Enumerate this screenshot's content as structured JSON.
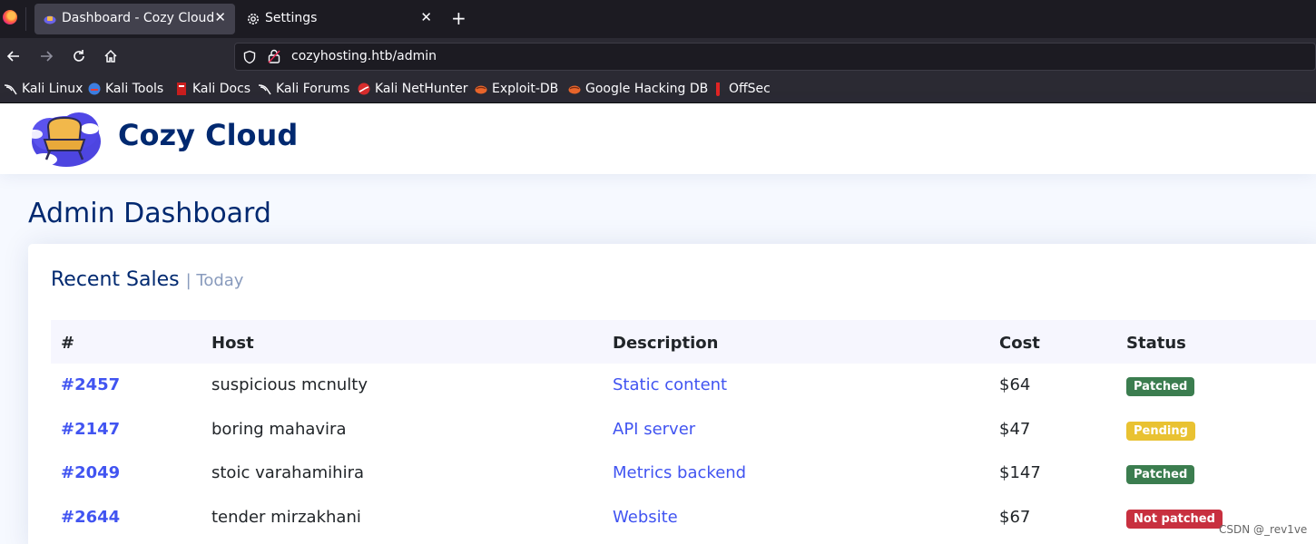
{
  "browser": {
    "tabs": [
      {
        "title": "Dashboard - Cozy Cloud",
        "active": true,
        "icon": "cozy-cloud-favicon"
      },
      {
        "title": "Settings",
        "active": false,
        "icon": "gear-icon"
      }
    ],
    "url": "cozyhosting.htb/admin",
    "bookmarks": [
      {
        "label": "Kali Linux",
        "icon": "kali-dragon-icon"
      },
      {
        "label": "Kali Tools",
        "icon": "kali-tools-icon"
      },
      {
        "label": "Kali Docs",
        "icon": "kali-docs-icon"
      },
      {
        "label": "Kali Forums",
        "icon": "kali-dragon-icon"
      },
      {
        "label": "Kali NetHunter",
        "icon": "nethunter-icon"
      },
      {
        "label": "Exploit-DB",
        "icon": "exploit-db-icon"
      },
      {
        "label": "Google Hacking DB",
        "icon": "ghdb-icon"
      },
      {
        "label": "OffSec",
        "icon": "offsec-icon"
      }
    ]
  },
  "site": {
    "logo_text": "Cozy Cloud"
  },
  "page": {
    "title": "Admin Dashboard"
  },
  "sales": {
    "title": "Recent Sales",
    "subtitle": "| Today",
    "columns": [
      "#",
      "Host",
      "Description",
      "Cost",
      "Status"
    ],
    "rows": [
      {
        "id": "#2457",
        "host": "suspicious mcnulty",
        "description": "Static content",
        "cost": "$64",
        "status": "Patched",
        "status_type": "patched"
      },
      {
        "id": "#2147",
        "host": "boring mahavira",
        "description": "API server",
        "cost": "$47",
        "status": "Pending",
        "status_type": "pending"
      },
      {
        "id": "#2049",
        "host": "stoic varahamihira",
        "description": "Metrics backend",
        "cost": "$147",
        "status": "Patched",
        "status_type": "patched"
      },
      {
        "id": "#2644",
        "host": "tender mirzakhani",
        "description": "Website",
        "cost": "$67",
        "status": "Not patched",
        "status_type": "notpatched"
      }
    ]
  },
  "colors": {
    "brand": "#012970",
    "link": "#4154f1",
    "patched": "#3b7d4f",
    "pending": "#e9c232",
    "not_patched": "#c8303f"
  },
  "watermark": "CSDN @_rev1ve"
}
